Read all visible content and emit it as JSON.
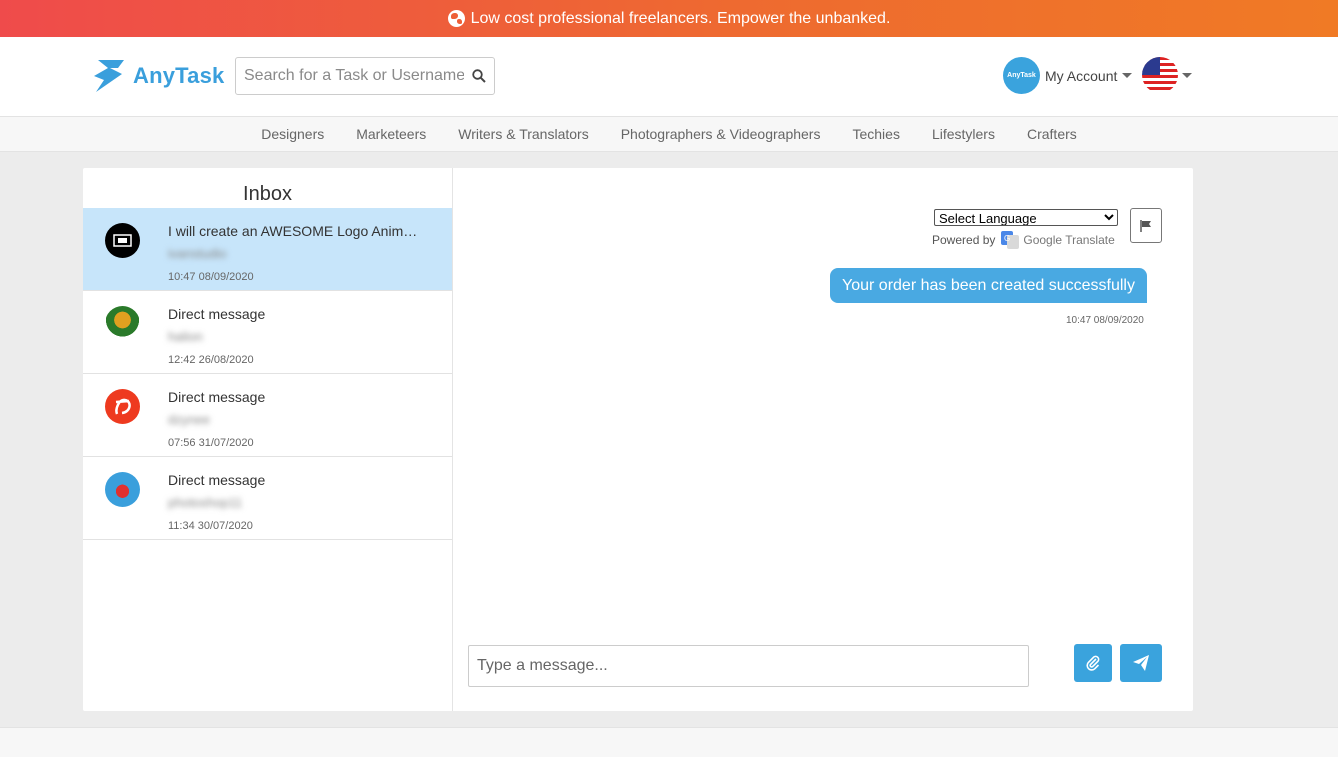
{
  "banner": {
    "text": "Low cost professional freelancers. Empower the unbanked."
  },
  "header": {
    "logo_text": "AnyTask",
    "search_placeholder": "Search for a Task or Username",
    "account_label": "My Account",
    "account_avatar_text": "AnyTask",
    "locale_icon": "us-flag-icon"
  },
  "categories": [
    "Designers",
    "Marketeers",
    "Writers & Translators",
    "Photographers & Videographers",
    "Techies",
    "Lifestylers",
    "Crafters"
  ],
  "inbox": {
    "title": "Inbox",
    "conversations": [
      {
        "title": "I will create an AWESOME Logo Animation",
        "user": "ivanstudio",
        "time": "10:47 08/09/2020",
        "active": true,
        "avatar_color": "#000000"
      },
      {
        "title": "Direct message",
        "user": "halion",
        "time": "12:42 26/08/2020",
        "active": false,
        "avatar_color": "#2a7a2a"
      },
      {
        "title": "Direct message",
        "user": "dzynee",
        "time": "07:56 31/07/2020",
        "active": false,
        "avatar_color": "#ee3a1f"
      },
      {
        "title": "Direct message",
        "user": "photoshop11",
        "time": "11:34 30/07/2020",
        "active": false,
        "avatar_color": "#3a9fdc"
      }
    ]
  },
  "chat": {
    "language_select": "Select Language",
    "powered_by": "Powered by",
    "google_translate": "Google Translate",
    "messages": [
      {
        "text": "Your order has been created successfully",
        "time": "10:47 08/09/2020"
      }
    ],
    "composer_placeholder": "Type a message..."
  },
  "colors": {
    "accent": "#3aa3dd",
    "banner_start": "#ef4b4b",
    "banner_end": "#f07a25",
    "active_row": "#c7e5fa"
  }
}
